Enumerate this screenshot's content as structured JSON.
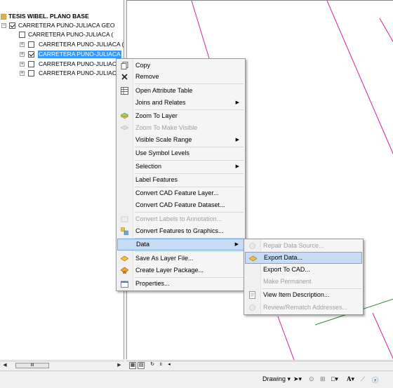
{
  "toc": {
    "root_label": "TESIS WIBEL. PLANO BASE",
    "layers": [
      {
        "label": "CARRETERA PUNO-JULIACA GEO",
        "checked": true,
        "expanded": true
      },
      {
        "label": "CARRETERA PUNO-JULIACA (",
        "checked": false
      },
      {
        "label": "CARRETERA PUNO-JULIACA (",
        "checked": false
      },
      {
        "label": "CARRETERA PUNO-JULIACA",
        "checked": true,
        "selected": true
      },
      {
        "label": "CARRETERA PUNO-JULIACA",
        "checked": false
      },
      {
        "label": "CARRETERA PUNO-JULIACA",
        "checked": false
      }
    ],
    "scroll_thumb": "III"
  },
  "context_menu": {
    "items": [
      {
        "label": "Copy",
        "icon": "copy-icon"
      },
      {
        "label": "Remove",
        "icon": "remove-x-icon"
      },
      {
        "label": "Open Attribute Table",
        "icon": "table-icon"
      },
      {
        "label": "Joins and Relates",
        "submenu": true
      },
      {
        "label": "Zoom To Layer",
        "icon": "zoom-layer-icon"
      },
      {
        "label": "Zoom To Make Visible",
        "icon": "zoom-visible-icon",
        "disabled": true
      },
      {
        "label": "Visible Scale Range",
        "submenu": true
      },
      {
        "label": "Use Symbol Levels"
      },
      {
        "label": "Selection",
        "submenu": true
      },
      {
        "label": "Label Features"
      },
      {
        "label": "Convert CAD Feature Layer..."
      },
      {
        "label": "Convert CAD Feature Dataset..."
      },
      {
        "label": "Convert Labels to Annotation...",
        "icon": "labels-annotation-icon",
        "disabled": true
      },
      {
        "label": "Convert Features to Graphics...",
        "icon": "features-graphics-icon"
      },
      {
        "label": "Data",
        "submenu": true,
        "active": true
      },
      {
        "label": "Save As Layer File...",
        "icon": "layer-file-icon"
      },
      {
        "label": "Create Layer Package...",
        "icon": "layer-package-icon"
      },
      {
        "label": "Properties...",
        "icon": "properties-icon"
      }
    ]
  },
  "data_submenu": {
    "items": [
      {
        "label": "Repair Data Source...",
        "icon": "repair-source-icon",
        "disabled": true
      },
      {
        "label": "Export Data...",
        "icon": "export-data-icon",
        "active": true
      },
      {
        "label": "Export To CAD..."
      },
      {
        "label": "Make Permanent",
        "disabled": true
      },
      {
        "label": "View Item Description...",
        "icon": "item-description-icon"
      },
      {
        "label": "Review/Rematch Addresses...",
        "icon": "rematch-icon",
        "disabled": true
      }
    ]
  },
  "bottom_toolbar": {
    "drawing_label": "Drawing",
    "font_a": "A"
  },
  "colors": {
    "selection": "#3399ff",
    "road_line": "#d020a0",
    "menu_highlight": "#c6dcf5",
    "green_line": "#2a8a3a"
  }
}
